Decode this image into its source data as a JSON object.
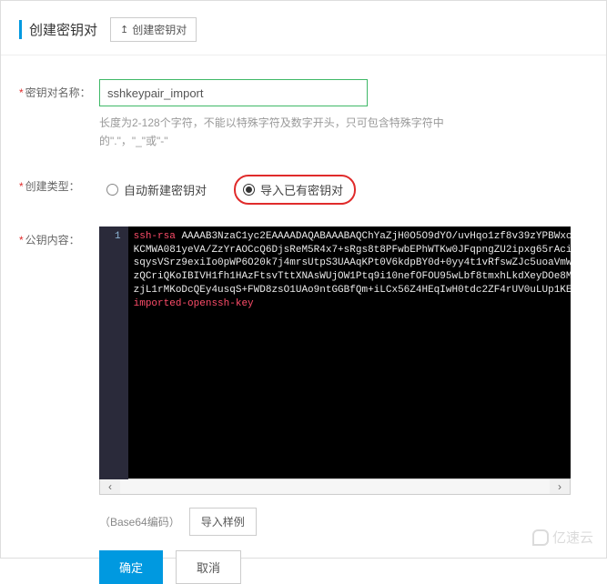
{
  "header": {
    "title": "创建密钥对",
    "create_btn": "创建密钥对"
  },
  "form": {
    "name": {
      "label": "密钥对名称：",
      "value": "sshkeypair_import",
      "hint": "长度为2-128个字符，不能以特殊字符及数字开头，只可包含特殊字符中的\".\"，\"_\"或\"-\""
    },
    "type": {
      "label": "创建类型：",
      "options": {
        "auto": "自动新建密钥对",
        "import": "导入已有密钥对"
      },
      "selected": "import"
    },
    "pubkey": {
      "label": "公钥内容：",
      "gutter": "1",
      "line_keyword": "ssh-rsa",
      "line1": " AAAAB3NzaC1yc2EAAAADAQABAAABAQChYaZjH0O5O9dYO/uvHqo1zf8v39zYPBWxc",
      "line2": "KCMWA081yeVA/ZzYrAOCcQ6DjsReM5R4x7+sRgs8t8PFwbEPhWTKw0JFqpngZU2ipxg65rAci",
      "line3": "sqysVSrz9exiIo0pWP6O20k7j4mrsUtpS3UAAqKPt0V6kdpBY0d+0yy4t1vRfswZJc5uoaVmW",
      "line4": "zQCriQKoIBIVH1fh1HAzFtsvTttXNAsWUjOW1Ptq9i10nefOFOU95wLbf8tmxhLkdXeyDOe8M",
      "line5": "zjL1rMKoDcQEy4usqS+FWD8zsO1UAo9ntGGBfQm+iLCx56Z4HEqIwH0tdc2ZF4rUV0uLUp1KE",
      "imported_key": "imported-openssh-key",
      "encoding_hint": "（Base64编码）",
      "import_sample": "导入样例"
    }
  },
  "actions": {
    "ok": "确定",
    "cancel": "取消"
  },
  "watermark": "亿速云"
}
